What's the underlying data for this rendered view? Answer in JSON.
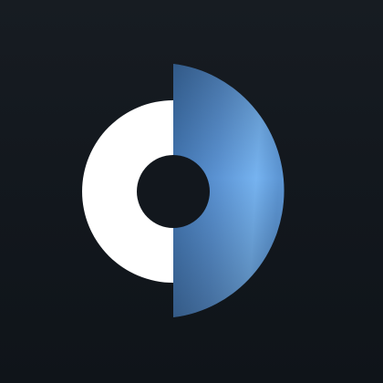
{
  "logo": {
    "name": "split-ring-logo",
    "colors": {
      "background": "#12171d",
      "ring": "#ffffff",
      "hole": "#12171d",
      "accent_light": "#6aa6e8",
      "accent_mid": "#4d86c6",
      "accent_dark": "#2d5688"
    }
  }
}
